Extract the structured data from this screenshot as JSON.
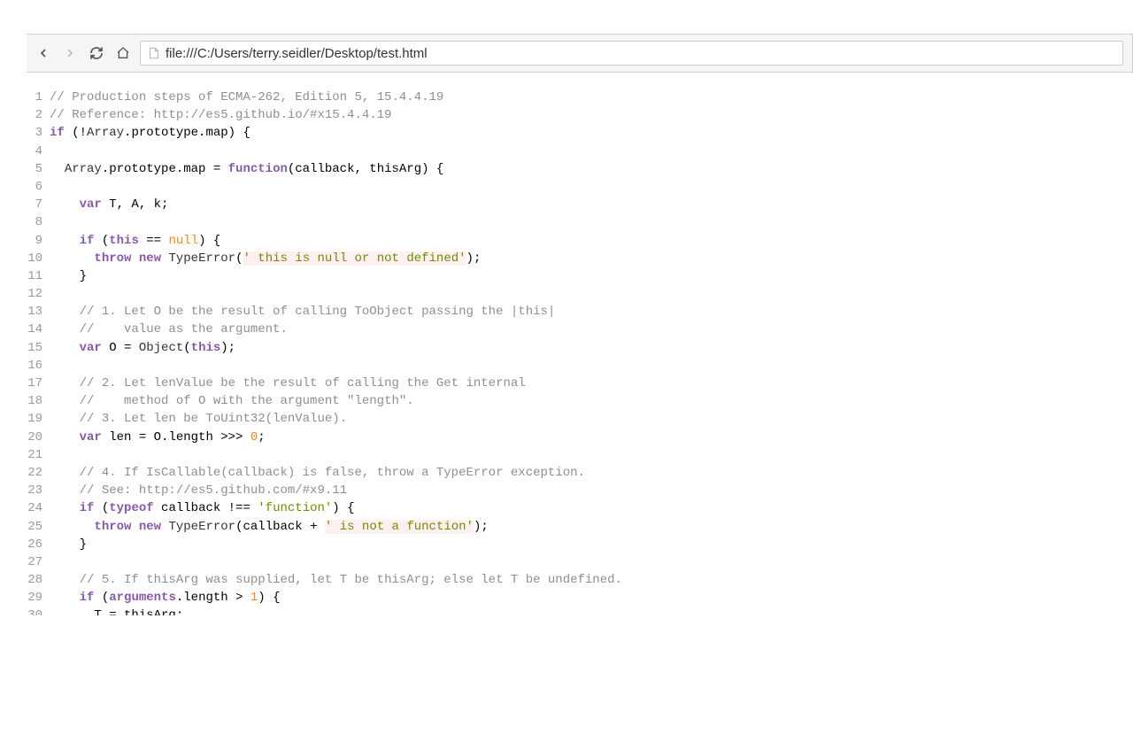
{
  "browser": {
    "url": "file:///C:/Users/terry.seidler/Desktop/test.html"
  },
  "code": {
    "lines": [
      {
        "n": 1,
        "tokens": [
          {
            "c": "tok-comment",
            "t": "// Production steps of ECMA-262, Edition 5, 15.4.4.19"
          }
        ]
      },
      {
        "n": 2,
        "tokens": [
          {
            "c": "tok-comment",
            "t": "// Reference: http://es5.github.io/#x15.4.4.19"
          }
        ]
      },
      {
        "n": 3,
        "tokens": [
          {
            "c": "tok-keyword",
            "t": "if"
          },
          {
            "c": "",
            "t": " (!"
          },
          {
            "c": "tok-class",
            "t": "Array"
          },
          {
            "c": "",
            "t": ".prototype.map) {"
          }
        ]
      },
      {
        "n": 4,
        "tokens": []
      },
      {
        "n": 5,
        "tokens": [
          {
            "c": "",
            "t": "  "
          },
          {
            "c": "tok-class",
            "t": "Array"
          },
          {
            "c": "",
            "t": ".prototype.map = "
          },
          {
            "c": "tok-keyword",
            "t": "function"
          },
          {
            "c": "",
            "t": "(callback, thisArg) {"
          }
        ]
      },
      {
        "n": 6,
        "tokens": []
      },
      {
        "n": 7,
        "tokens": [
          {
            "c": "",
            "t": "    "
          },
          {
            "c": "tok-keyword",
            "t": "var"
          },
          {
            "c": "",
            "t": " T, A, k;"
          }
        ]
      },
      {
        "n": 8,
        "tokens": []
      },
      {
        "n": 9,
        "tokens": [
          {
            "c": "",
            "t": "    "
          },
          {
            "c": "tok-keyword",
            "t": "if"
          },
          {
            "c": "",
            "t": " ("
          },
          {
            "c": "tok-keyword",
            "t": "this"
          },
          {
            "c": "",
            "t": " == "
          },
          {
            "c": "tok-literal",
            "t": "null"
          },
          {
            "c": "",
            "t": ") {"
          }
        ]
      },
      {
        "n": 10,
        "tokens": [
          {
            "c": "",
            "t": "      "
          },
          {
            "c": "tok-keyword",
            "t": "throw"
          },
          {
            "c": "",
            "t": " "
          },
          {
            "c": "tok-keyword",
            "t": "new"
          },
          {
            "c": "",
            "t": " "
          },
          {
            "c": "tok-class",
            "t": "TypeError"
          },
          {
            "c": "",
            "t": "("
          },
          {
            "c": "tok-string",
            "t": "' this is null or not defined'"
          },
          {
            "c": "",
            "t": ");"
          }
        ]
      },
      {
        "n": 11,
        "tokens": [
          {
            "c": "",
            "t": "    }"
          }
        ]
      },
      {
        "n": 12,
        "tokens": []
      },
      {
        "n": 13,
        "tokens": [
          {
            "c": "",
            "t": "    "
          },
          {
            "c": "tok-comment",
            "t": "// 1. Let O be the result of calling ToObject passing the |this| "
          }
        ]
      },
      {
        "n": 14,
        "tokens": [
          {
            "c": "",
            "t": "    "
          },
          {
            "c": "tok-comment",
            "t": "//    value as the argument."
          }
        ]
      },
      {
        "n": 15,
        "tokens": [
          {
            "c": "",
            "t": "    "
          },
          {
            "c": "tok-keyword",
            "t": "var"
          },
          {
            "c": "",
            "t": " O = "
          },
          {
            "c": "tok-class",
            "t": "Object"
          },
          {
            "c": "",
            "t": "("
          },
          {
            "c": "tok-keyword",
            "t": "this"
          },
          {
            "c": "",
            "t": ");"
          }
        ]
      },
      {
        "n": 16,
        "tokens": []
      },
      {
        "n": 17,
        "tokens": [
          {
            "c": "",
            "t": "    "
          },
          {
            "c": "tok-comment",
            "t": "// 2. Let lenValue be the result of calling the Get internal "
          }
        ]
      },
      {
        "n": 18,
        "tokens": [
          {
            "c": "",
            "t": "    "
          },
          {
            "c": "tok-comment",
            "t": "//    method of O with the argument \"length\"."
          }
        ]
      },
      {
        "n": 19,
        "tokens": [
          {
            "c": "",
            "t": "    "
          },
          {
            "c": "tok-comment",
            "t": "// 3. Let len be ToUint32(lenValue)."
          }
        ]
      },
      {
        "n": 20,
        "tokens": [
          {
            "c": "",
            "t": "    "
          },
          {
            "c": "tok-keyword",
            "t": "var"
          },
          {
            "c": "",
            "t": " len = O.length >>> "
          },
          {
            "c": "tok-number",
            "t": "0"
          },
          {
            "c": "",
            "t": ";"
          }
        ]
      },
      {
        "n": 21,
        "tokens": []
      },
      {
        "n": 22,
        "tokens": [
          {
            "c": "",
            "t": "    "
          },
          {
            "c": "tok-comment",
            "t": "// 4. If IsCallable(callback) is false, throw a TypeError exception. "
          }
        ]
      },
      {
        "n": 23,
        "tokens": [
          {
            "c": "",
            "t": "    "
          },
          {
            "c": "tok-comment",
            "t": "// See: http://es5.github.com/#x9.11"
          }
        ]
      },
      {
        "n": 24,
        "tokens": [
          {
            "c": "",
            "t": "    "
          },
          {
            "c": "tok-keyword",
            "t": "if"
          },
          {
            "c": "",
            "t": " ("
          },
          {
            "c": "tok-keyword",
            "t": "typeof"
          },
          {
            "c": "",
            "t": " callback !== "
          },
          {
            "c": "tok-string-nb",
            "t": "'function'"
          },
          {
            "c": "",
            "t": ") {"
          }
        ]
      },
      {
        "n": 25,
        "tokens": [
          {
            "c": "",
            "t": "      "
          },
          {
            "c": "tok-keyword",
            "t": "throw"
          },
          {
            "c": "",
            "t": " "
          },
          {
            "c": "tok-keyword",
            "t": "new"
          },
          {
            "c": "",
            "t": " "
          },
          {
            "c": "tok-class",
            "t": "TypeError"
          },
          {
            "c": "",
            "t": "(callback + "
          },
          {
            "c": "tok-string",
            "t": "' is not a function'"
          },
          {
            "c": "",
            "t": ");"
          }
        ]
      },
      {
        "n": 26,
        "tokens": [
          {
            "c": "",
            "t": "    }"
          }
        ]
      },
      {
        "n": 27,
        "tokens": []
      },
      {
        "n": 28,
        "tokens": [
          {
            "c": "",
            "t": "    "
          },
          {
            "c": "tok-comment",
            "t": "// 5. If thisArg was supplied, let T be thisArg; else let T be undefined."
          }
        ]
      },
      {
        "n": 29,
        "tokens": [
          {
            "c": "",
            "t": "    "
          },
          {
            "c": "tok-keyword",
            "t": "if"
          },
          {
            "c": "",
            "t": " ("
          },
          {
            "c": "tok-keyword",
            "t": "arguments"
          },
          {
            "c": "",
            "t": ".length > "
          },
          {
            "c": "tok-number",
            "t": "1"
          },
          {
            "c": "",
            "t": ") {"
          }
        ]
      },
      {
        "n": 30,
        "tokens": [
          {
            "c": "",
            "t": "      T = thisArg;"
          }
        ],
        "cut": true
      }
    ]
  }
}
